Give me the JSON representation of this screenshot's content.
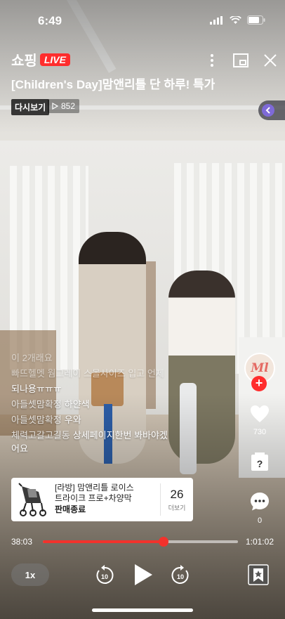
{
  "status_bar": {
    "time": "6:49"
  },
  "header": {
    "brand": "쇼핑",
    "live_badge": "LIVE",
    "title": "[Children's Day]맘앤리틀 단 하루! 특가",
    "replay_label": "다시보기",
    "view_count": "852"
  },
  "chat": {
    "messages": [
      {
        "user": "",
        "text": "이 2개래요",
        "faded": true
      },
      {
        "user": "",
        "text": "빠뜨헬멧 웜그레이 스몰사이즈 입고 언제",
        "faded": true
      },
      {
        "user": "",
        "text": "되나용ㅠㅠㅠ"
      },
      {
        "user": "아들셋맘확정",
        "text": "하얀색"
      },
      {
        "user": "아들셋맘확정",
        "text": "우와"
      },
      {
        "user": "체력고갈고길동",
        "text": "상세페이지한번 봐바야겠"
      },
      {
        "user": "",
        "text": "어요"
      }
    ]
  },
  "rail": {
    "avatar_text": "Ml",
    "like_count": "730",
    "comment_count": "0"
  },
  "product": {
    "name_line1": "[라방] 맘앤리틀 로이스",
    "name_line2": "트라이크 프로+차양막",
    "status": "판매종료",
    "count": "26",
    "more_label": "더보기"
  },
  "player": {
    "current_time": "38:03",
    "total_time": "1:01:02",
    "progress": 0.62,
    "speed": "1x",
    "skip_back": "10",
    "skip_forward": "10",
    "accent_color": "#f2322c"
  }
}
